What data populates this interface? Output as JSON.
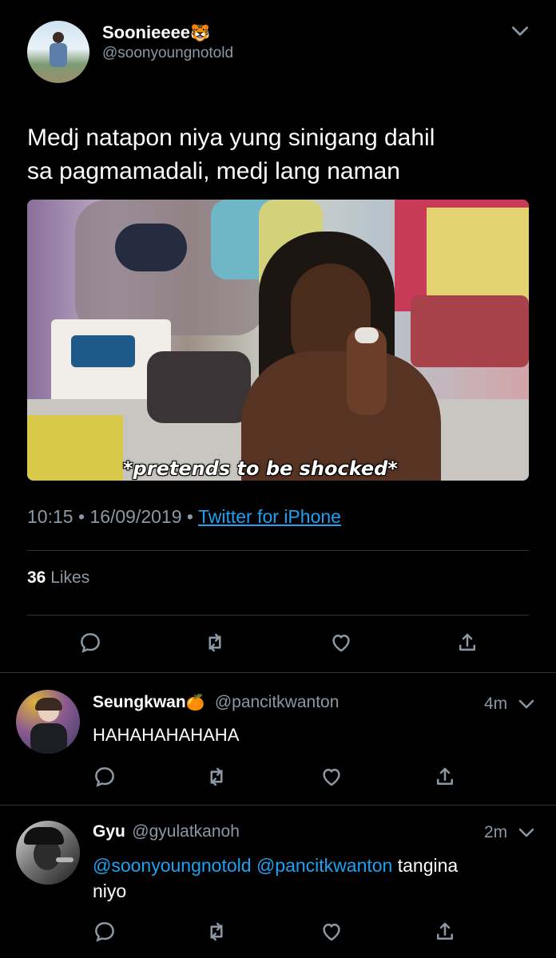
{
  "tweet": {
    "author_name": "Soonieeee",
    "author_emoji": "🐯",
    "author_handle": "@soonyoungnotold",
    "text_line1": "Medj natapon niya yung sinigang dahil",
    "text_line2": "sa pagmamadali, medj lang naman",
    "media_caption": "*pretends to be shocked*",
    "time": "10:15",
    "date": "16/09/2019",
    "separator": "•",
    "source": "Twitter for iPhone",
    "likes_count": "36",
    "likes_label": "Likes"
  },
  "replies": [
    {
      "author_name": "Seungkwan",
      "author_emoji": "🍊",
      "author_handle": "@pancitkwanton",
      "age": "4m",
      "text": "HAHAHAHAHAHA"
    },
    {
      "author_name": "Gyu",
      "author_handle": "@gyulatkanoh",
      "age": "2m",
      "mention1": "@soonyoungnotold",
      "mention2": "@pancitkwanton",
      "text_rest": "tangina",
      "text_line2": "niyo"
    }
  ],
  "icons": [
    "chevron-down-icon",
    "reply-icon",
    "retweet-icon",
    "like-icon",
    "share-icon"
  ],
  "colors": {
    "background": "#000000",
    "link": "#1da1f2",
    "muted": "#8b98a5",
    "divider": "#2f3336"
  }
}
